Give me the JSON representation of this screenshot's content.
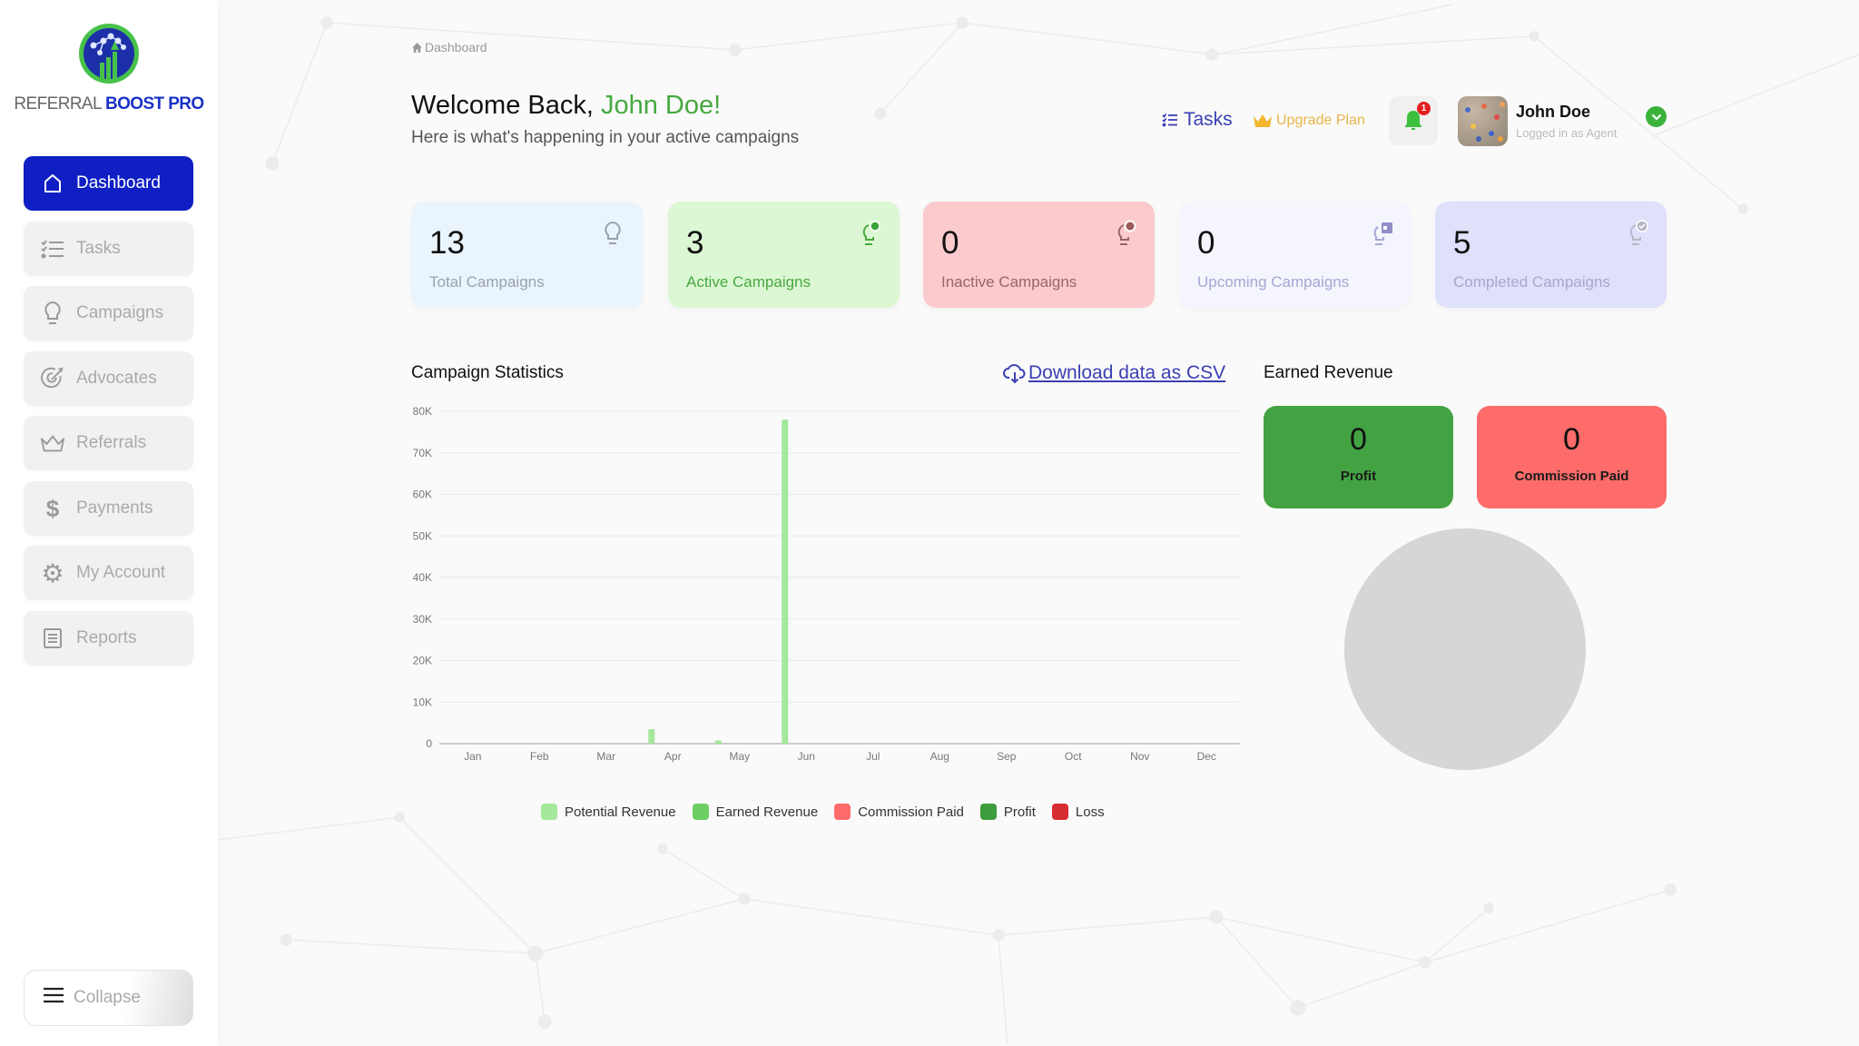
{
  "brand": {
    "name_part1": "REFERRAL",
    "name_part2": "BOOST PRO",
    "icon": "growth-network-logo"
  },
  "sidebar": {
    "items": [
      {
        "label": "Dashboard",
        "icon": "home-icon",
        "active": true
      },
      {
        "label": "Tasks",
        "icon": "checklist-icon",
        "active": false
      },
      {
        "label": "Campaigns",
        "icon": "lightbulb-icon",
        "active": false
      },
      {
        "label": "Advocates",
        "icon": "target-icon",
        "active": false
      },
      {
        "label": "Referrals",
        "icon": "crown-icon",
        "active": false
      },
      {
        "label": "Payments",
        "icon": "dollar-icon",
        "active": false
      },
      {
        "label": "My Account",
        "icon": "gear-icon",
        "active": false
      },
      {
        "label": "Reports",
        "icon": "report-icon",
        "active": false
      }
    ],
    "collapse_label": "Collapse"
  },
  "breadcrumb": {
    "label": "Dashboard",
    "icon": "home-icon"
  },
  "header": {
    "welcome_prefix": "Welcome Back, ",
    "welcome_name": "John Doe!",
    "subtitle": "Here is what's happening in your active campaigns",
    "tasks_label": "Tasks",
    "upgrade_label": "Upgrade Plan",
    "notification_count": "1",
    "user_name": "John Doe",
    "user_role": "Logged in as Agent"
  },
  "stats": [
    {
      "value": "13",
      "label": "Total Campaigns",
      "bg": "#eaf4fd",
      "label_color": "#9aa3ad"
    },
    {
      "value": "3",
      "label": "Active Campaigns",
      "bg": "#dcf7d3",
      "label_color": "#48a93f"
    },
    {
      "value": "0",
      "label": "Inactive Campaigns",
      "bg": "#fbcacc",
      "label_color": "#9c6468"
    },
    {
      "value": "0",
      "label": "Upcoming Campaigns",
      "bg": "#f4f5fd",
      "label_color": "#a7a6d4"
    },
    {
      "value": "5",
      "label": "Completed Campaigns",
      "bg": "#dfe0fa",
      "label_color": "#a7a8cf"
    }
  ],
  "campaign_statistics": {
    "title": "Campaign Statistics",
    "download_label": "Download data as CSV"
  },
  "earned_revenue": {
    "title": "Earned Revenue",
    "profit_value": "0",
    "profit_label": "Profit",
    "commission_value": "0",
    "commission_label": "Commission Paid",
    "profit_color": "#43a342",
    "commission_color": "#fd6c6a"
  },
  "chart_data": [
    {
      "type": "bar",
      "title": "Campaign Statistics",
      "xlabel": "",
      "ylabel": "",
      "categories": [
        "Jan",
        "Feb",
        "Mar",
        "Apr",
        "May",
        "Jun",
        "Jul",
        "Aug",
        "Sep",
        "Oct",
        "Nov",
        "Dec"
      ],
      "yticks": [
        "0",
        "10K",
        "20K",
        "30K",
        "40K",
        "50K",
        "60K",
        "70K",
        "80K"
      ],
      "ylim": [
        0,
        80000
      ],
      "grid": true,
      "legend_position": "bottom",
      "series": [
        {
          "name": "Potential Revenue",
          "color": "#a3e89b",
          "values": [
            0,
            0,
            0,
            3500,
            800,
            78000,
            0,
            0,
            0,
            0,
            0,
            0
          ]
        },
        {
          "name": "Earned Revenue",
          "color": "#6dcf63",
          "values": [
            0,
            0,
            0,
            0,
            0,
            0,
            0,
            0,
            0,
            0,
            0,
            0
          ]
        },
        {
          "name": "Commission Paid",
          "color": "#fd6c6a",
          "values": [
            0,
            0,
            0,
            0,
            0,
            0,
            0,
            0,
            0,
            0,
            0,
            0
          ]
        },
        {
          "name": "Profit",
          "color": "#3d9c3c",
          "values": [
            0,
            0,
            0,
            0,
            0,
            0,
            0,
            0,
            0,
            0,
            0,
            0
          ]
        },
        {
          "name": "Loss",
          "color": "#d62d33",
          "values": [
            0,
            0,
            0,
            0,
            0,
            0,
            0,
            0,
            0,
            0,
            0,
            0
          ]
        }
      ]
    },
    {
      "type": "pie",
      "title": "Earned Revenue",
      "categories": [
        "Profit",
        "Commission Paid"
      ],
      "values": [
        0,
        0
      ],
      "empty_color": "#d6d6d6"
    }
  ]
}
